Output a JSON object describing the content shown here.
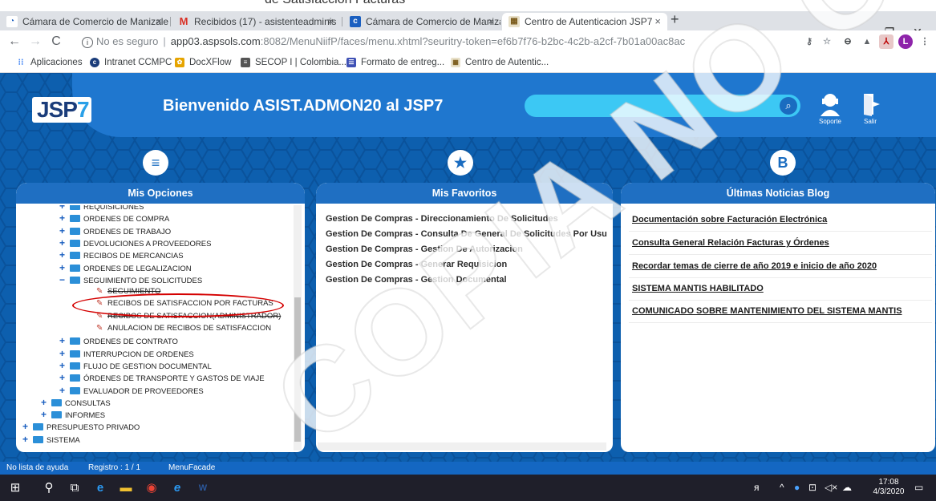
{
  "doc_heading": "de Satisfacción Facturas",
  "browser": {
    "tabs": [
      {
        "label": "Cámara de Comercio de Manizale",
        "icon": "ccm-icon"
      },
      {
        "label": "Recibidos (17) - asistenteadminis",
        "icon": "gmail-icon"
      },
      {
        "label": "Cámara de Comercio de Manizale",
        "icon": "ccm-icon"
      },
      {
        "label": "Centro de Autenticacion JSP7",
        "icon": "jsp7-icon"
      }
    ],
    "new_tab": "+",
    "url_security": "No es seguro",
    "url_host": "app03.aspsols.com",
    "url_rest": ":8082/MenuNiifP/faces/menu.xhtml?seuritry-token=ef6b7f76-b2bc-4c2b-a2cf-7b01a00ac8ac",
    "bookmarks": [
      {
        "label": "Aplicaciones",
        "icon": "apps-icon"
      },
      {
        "label": "Intranet CCMPC",
        "icon": "intranet-icon"
      },
      {
        "label": "DocXFlow",
        "icon": "docxflow-icon"
      },
      {
        "label": "SECOP I | Colombia...",
        "icon": "secop-icon"
      },
      {
        "label": "Formato de entreg...",
        "icon": "form-icon"
      },
      {
        "label": "Centro de Autentic...",
        "icon": "jsp7-icon"
      }
    ],
    "profile_letter": "L"
  },
  "app": {
    "logo_main": "SP",
    "logo_j": "J",
    "logo_seven": "7",
    "welcome": "Bienvenido ASIST.ADMON20 al JSP7",
    "search_placeholder": "",
    "support_label": "Soporte",
    "exit_label": "Salir"
  },
  "panels": {
    "options_title": "Mis Opciones",
    "favorites_title": "Mis Favoritos",
    "news_title": "Últimas Noticias Blog"
  },
  "tree": [
    {
      "label": "REQUISICIONES",
      "indent": 1,
      "kind": "folder",
      "sign": "+"
    },
    {
      "label": "ORDENES DE COMPRA",
      "indent": 1,
      "kind": "folder",
      "sign": "+"
    },
    {
      "label": "ORDENES DE TRABAJO",
      "indent": 1,
      "kind": "folder",
      "sign": "+"
    },
    {
      "label": "DEVOLUCIONES A PROVEEDORES",
      "indent": 1,
      "kind": "folder",
      "sign": "+"
    },
    {
      "label": "RECIBOS DE MERCANCIAS",
      "indent": 1,
      "kind": "folder",
      "sign": "+"
    },
    {
      "label": "ORDENES DE LEGALIZACION",
      "indent": 1,
      "kind": "folder",
      "sign": "+"
    },
    {
      "label": "SEGUIMIENTO DE SOLICITUDES",
      "indent": 1,
      "kind": "folder",
      "sign": "−"
    },
    {
      "label": "SEGUIMIENTO",
      "indent": 2,
      "kind": "item",
      "sign": "",
      "strike": true
    },
    {
      "label": "RECIBOS DE SATISFACCION POR FACTURAS",
      "indent": 2,
      "kind": "item",
      "sign": ""
    },
    {
      "label": "RECIBOS DE SATISFACCION(ADMINISTRADOR)",
      "indent": 2,
      "kind": "item",
      "sign": "",
      "strike": true
    },
    {
      "label": "ANULACION DE RECIBOS DE SATISFACCION",
      "indent": 2,
      "kind": "item",
      "sign": ""
    },
    {
      "label": "ORDENES DE CONTRATO",
      "indent": 1,
      "kind": "folder",
      "sign": "+"
    },
    {
      "label": "INTERRUPCION DE ORDENES",
      "indent": 1,
      "kind": "folder",
      "sign": "+"
    },
    {
      "label": "FLUJO DE GESTION DOCUMENTAL",
      "indent": 1,
      "kind": "folder",
      "sign": "+"
    },
    {
      "label": "ÓRDENES DE TRANSPORTE Y GASTOS DE VIAJE",
      "indent": 1,
      "kind": "folder",
      "sign": "+"
    },
    {
      "label": "EVALUADOR DE PROVEEDORES",
      "indent": 1,
      "kind": "folder",
      "sign": "+"
    },
    {
      "label": "CONSULTAS",
      "indent": 0.5,
      "kind": "folder",
      "sign": "+"
    },
    {
      "label": "INFORMES",
      "indent": 0.5,
      "kind": "folder",
      "sign": "+"
    },
    {
      "label": "PRESUPUESTO PRIVADO",
      "indent": 0,
      "kind": "folder",
      "sign": "+"
    },
    {
      "label": "SISTEMA",
      "indent": 0,
      "kind": "folder",
      "sign": "+"
    }
  ],
  "favorites": [
    "Gestion De Compras - Direccionamiento De Solicitudes",
    "Gestion De Compras - Consulta De General De Solicitudes Por Usu",
    "Gestion De Compras - Gestion De Autorizacion",
    "Gestion De Compras - Generar Requisicion",
    "Gestion De Compras - Gestion Documental"
  ],
  "news": [
    "Documentación sobre Facturación Electrónica",
    "Consulta General Relación Facturas y Órdenes",
    "Recordar temas de cierre de año 2019 e inicio de año 2020",
    "SISTEMA MANTIS HABILITADO",
    "COMUNICADO SOBRE MANTENIMIENTO DEL SISTEMA MANTIS"
  ],
  "status": {
    "help": "No lista de ayuda",
    "record": "Registro : 1 / 1",
    "facade": "MenuFacade"
  },
  "taskbar": {
    "time": "17:08",
    "date": "4/3/2020"
  },
  "watermark": "COPIA NO CONTROLADA",
  "colors": {
    "app_blue": "#0d5fae",
    "header_blue": "#1f77cf",
    "search_cyan": "#3cc8f4",
    "highlight_red": "#d40000"
  }
}
